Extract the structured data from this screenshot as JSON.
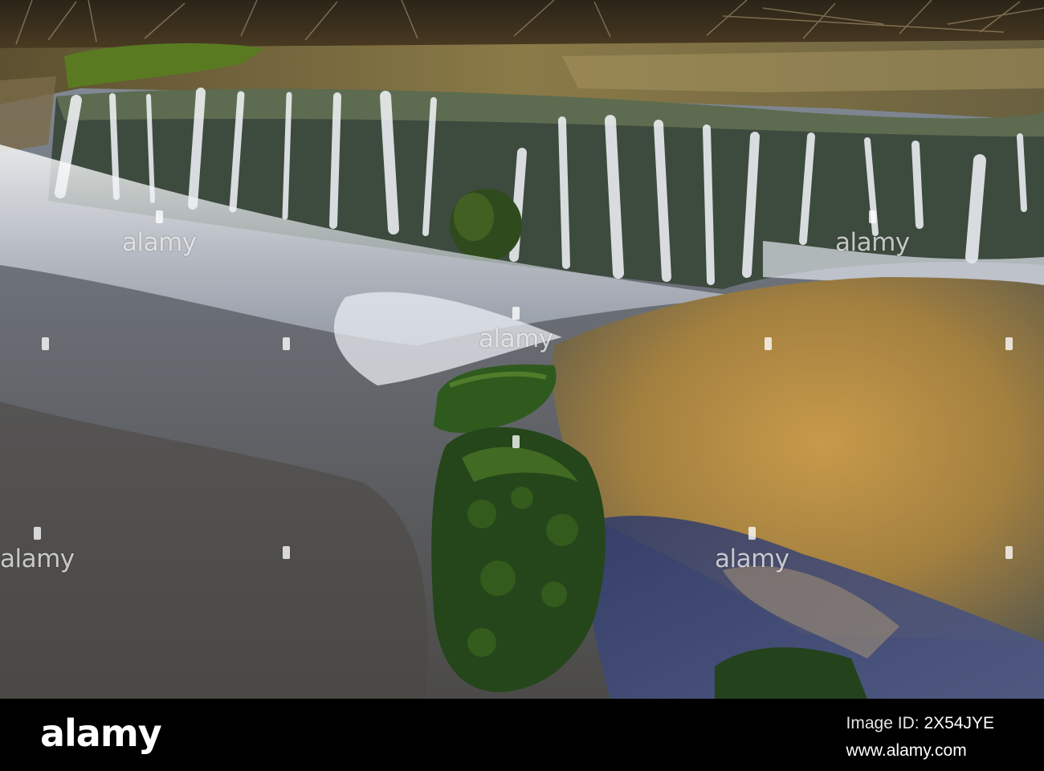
{
  "watermark": {
    "brand": "alamy",
    "colors": {
      "text": "#ffffff",
      "background": "#000000"
    }
  },
  "footer": {
    "logo_text": "alamy",
    "image_id_label": "Image ID:",
    "image_id": "2X54JYE",
    "url": "www.alamy.com"
  },
  "icons": [
    "watermark-dot-icon"
  ]
}
